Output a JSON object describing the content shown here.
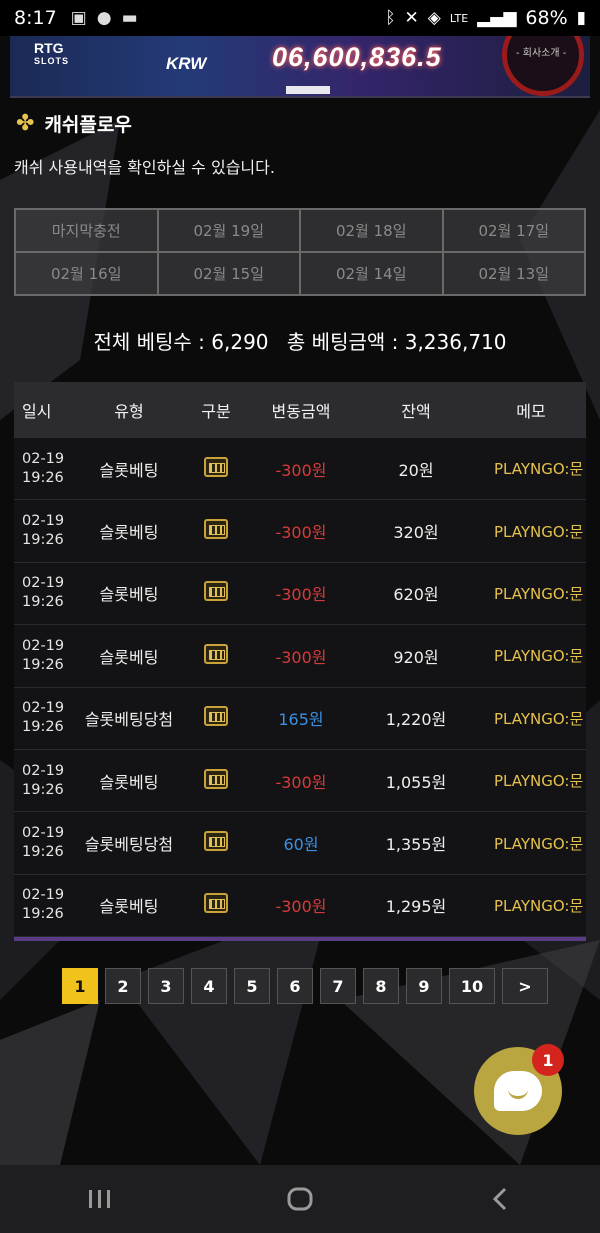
{
  "status_bar": {
    "time": "8:17",
    "battery": "68%",
    "network": "LTE",
    "left_icons": [
      "image-icon",
      "talk-icon",
      "message-icon"
    ],
    "right_icons": [
      "bluetooth-icon",
      "mute-icon",
      "data-saver-icon",
      "lte-icon",
      "signal-icon",
      "battery-icon"
    ]
  },
  "banner": {
    "brand": "RTG",
    "brand_sub": "SLOTS",
    "currency": "KRW",
    "jackpot": "06,600,836.5",
    "company_link": "- 회사소개 -"
  },
  "section": {
    "title": "캐쉬플로우",
    "description": "캐쉬 사용내역을 확인하실 수 있습니다."
  },
  "date_filters": [
    "마지막충전",
    "02월 19일",
    "02월 18일",
    "02월 17일",
    "02월 16일",
    "02월 15일",
    "02월 14일",
    "02월 13일"
  ],
  "totals": {
    "bet_count_label": "전체 베팅수 : 6,290",
    "bet_amount_label": "총 베팅금액 : 3,236,710"
  },
  "table": {
    "headers": [
      "일시",
      "유형",
      "구분",
      "변동금액",
      "잔액",
      "메모"
    ],
    "rows": [
      {
        "date": "02-19",
        "time": "19:26",
        "type": "슬롯베팅",
        "amount": "-300원",
        "amount_sign": "neg",
        "balance": "20원",
        "memo": "PLAYNGO:문 프"
      },
      {
        "date": "02-19",
        "time": "19:26",
        "type": "슬롯베팅",
        "amount": "-300원",
        "amount_sign": "neg",
        "balance": "320원",
        "memo": "PLAYNGO:문 프"
      },
      {
        "date": "02-19",
        "time": "19:26",
        "type": "슬롯베팅",
        "amount": "-300원",
        "amount_sign": "neg",
        "balance": "620원",
        "memo": "PLAYNGO:문 프"
      },
      {
        "date": "02-19",
        "time": "19:26",
        "type": "슬롯베팅",
        "amount": "-300원",
        "amount_sign": "neg",
        "balance": "920원",
        "memo": "PLAYNGO:문 프"
      },
      {
        "date": "02-19",
        "time": "19:26",
        "type": "슬롯베팅당첨",
        "amount": "165원",
        "amount_sign": "pos",
        "balance": "1,220원",
        "memo": "PLAYNGO:문 프"
      },
      {
        "date": "02-19",
        "time": "19:26",
        "type": "슬롯베팅",
        "amount": "-300원",
        "amount_sign": "neg",
        "balance": "1,055원",
        "memo": "PLAYNGO:문 프"
      },
      {
        "date": "02-19",
        "time": "19:26",
        "type": "슬롯베팅당첨",
        "amount": "60원",
        "amount_sign": "pos",
        "balance": "1,355원",
        "memo": "PLAYNGO:문 프"
      },
      {
        "date": "02-19",
        "time": "19:26",
        "type": "슬롯베팅",
        "amount": "-300원",
        "amount_sign": "neg",
        "balance": "1,295원",
        "memo": "PLAYNGO:문 프"
      }
    ]
  },
  "pagination": {
    "pages": [
      "1",
      "2",
      "3",
      "4",
      "5",
      "6",
      "7",
      "8",
      "9",
      "10"
    ],
    "active_page": "1",
    "next_label": ">"
  },
  "chat": {
    "badge_count": "1"
  },
  "colors": {
    "accent_yellow": "#f1c21c",
    "negative": "#d63a3a",
    "positive": "#3d8fe0",
    "memo": "#e6c24c"
  }
}
